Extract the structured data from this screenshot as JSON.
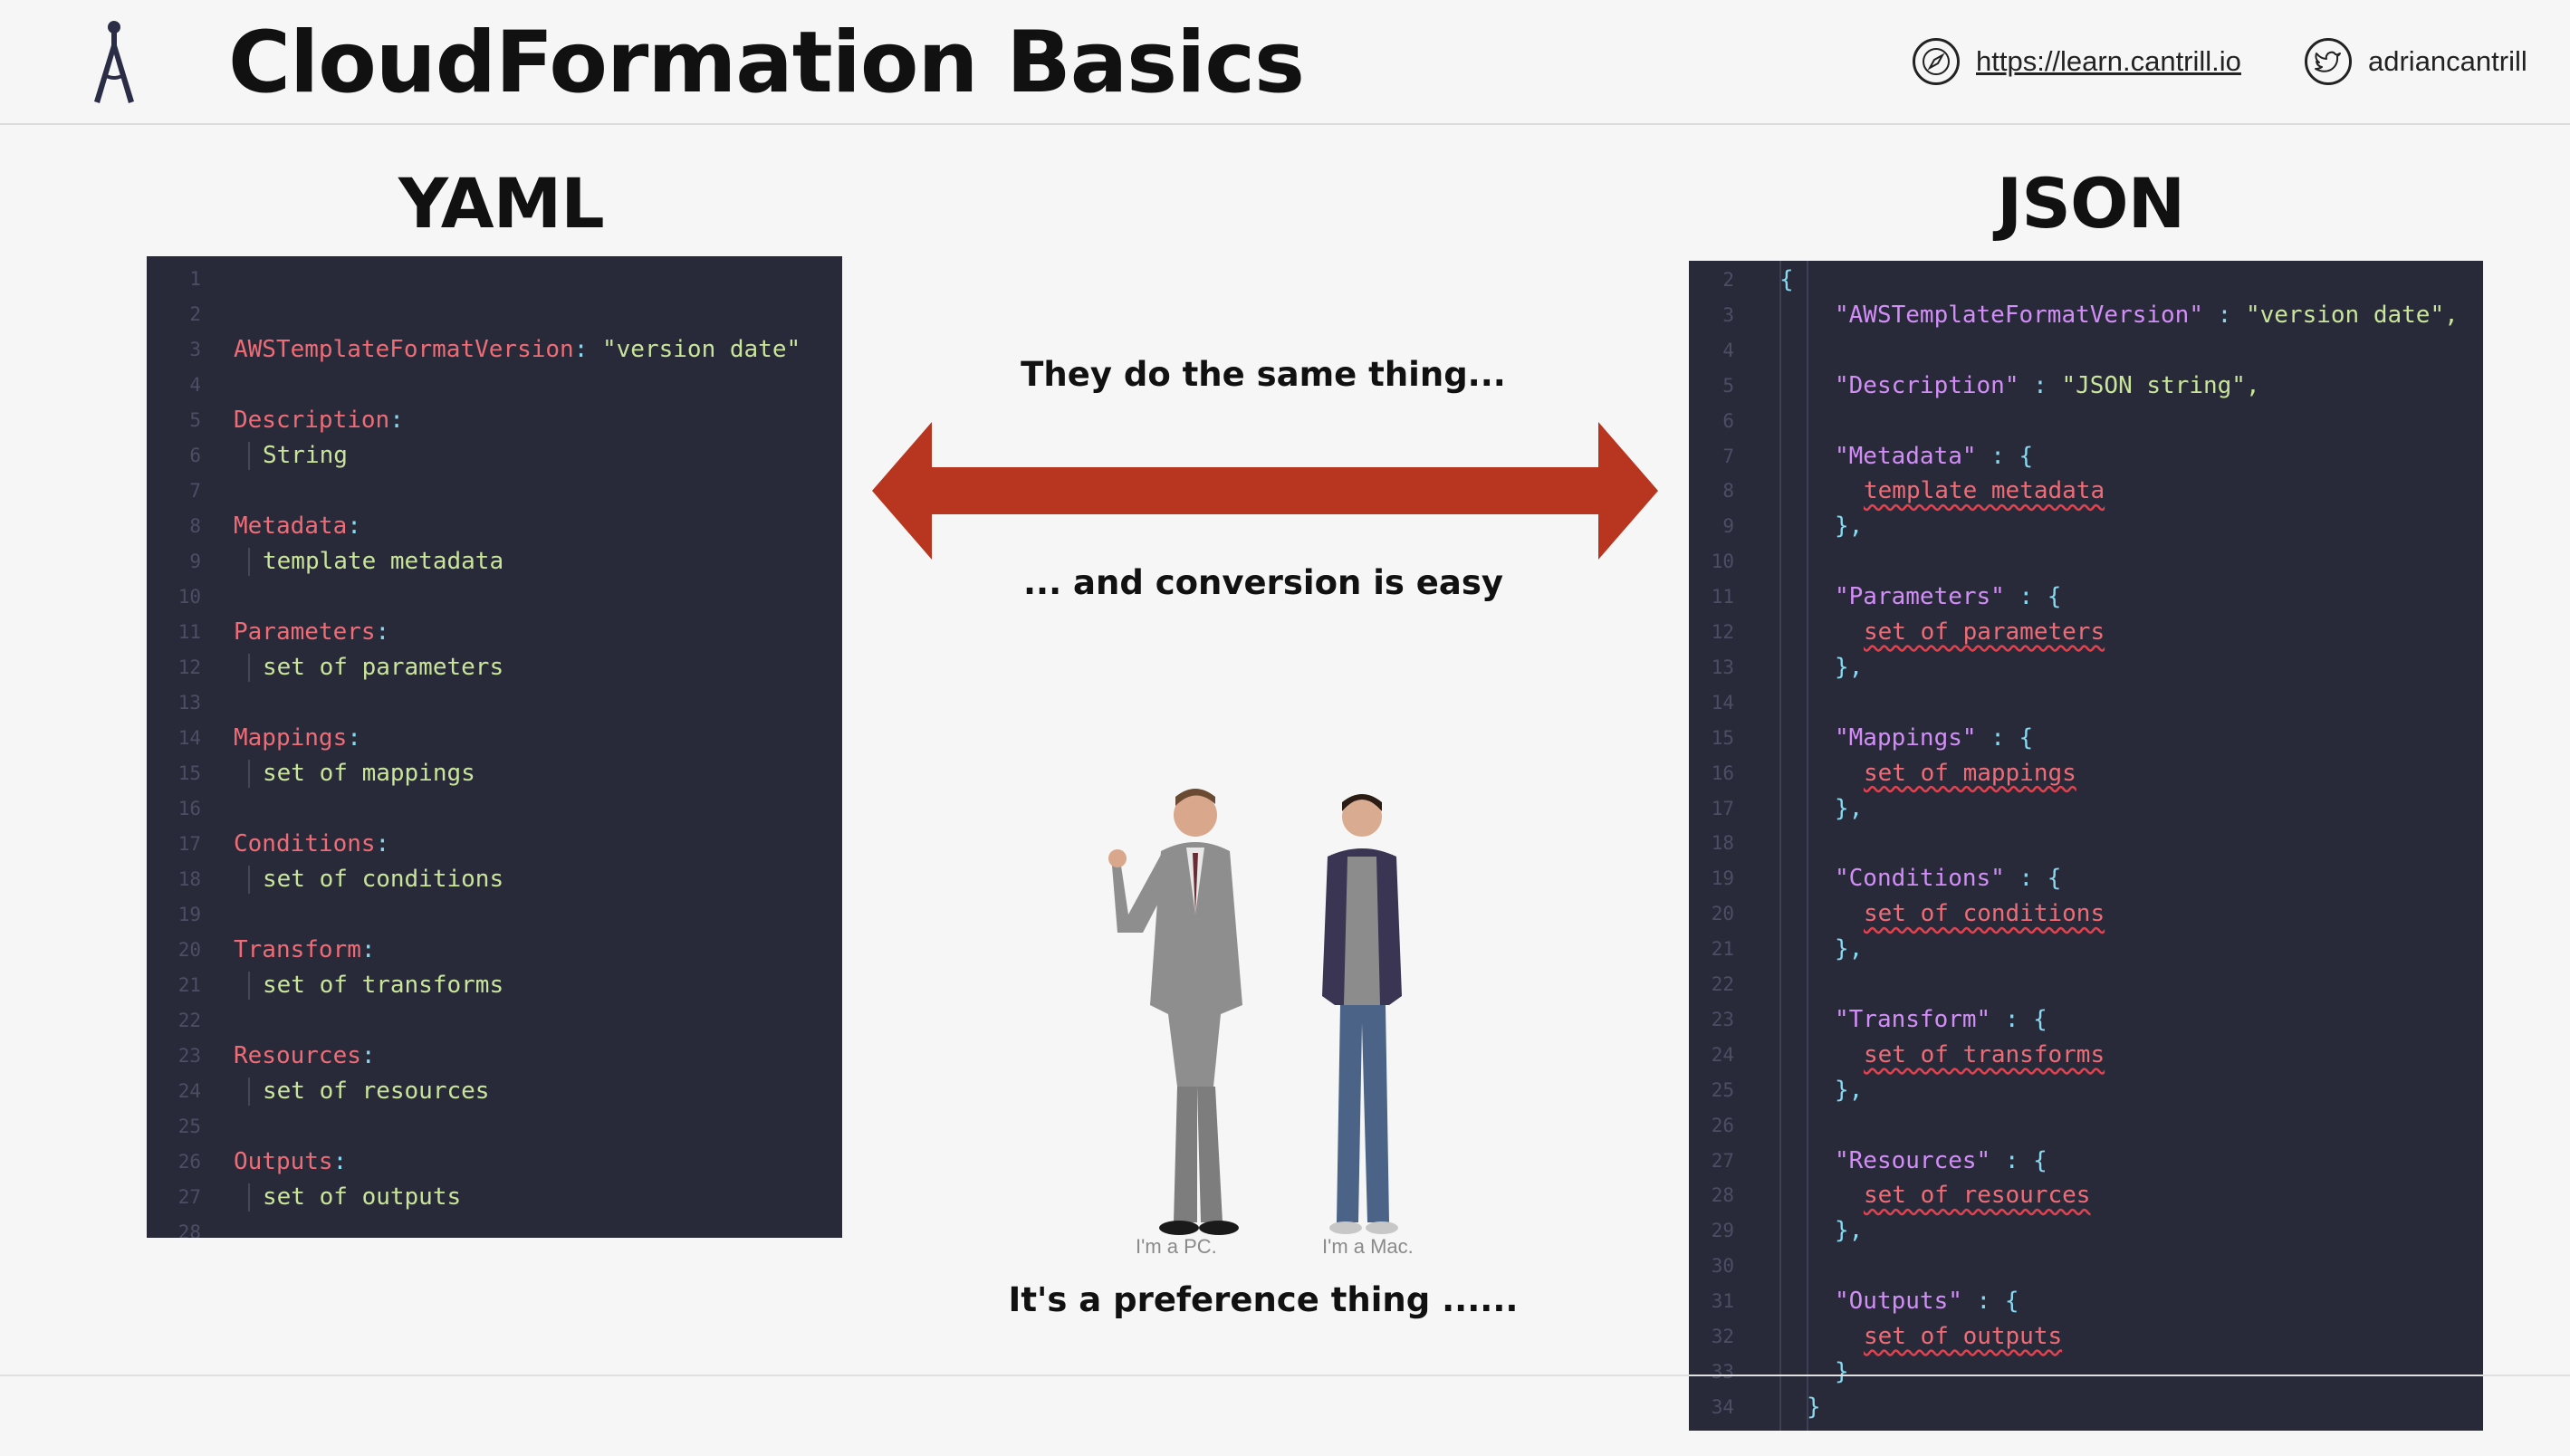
{
  "header": {
    "title": "CloudFormation Basics",
    "website": "https://learn.cantrill.io",
    "twitter": "adriancantrill",
    "logo_icon": "compass-icon",
    "website_icon": "safari-compass-icon",
    "twitter_icon": "twitter-bird-icon"
  },
  "yaml": {
    "title": "YAML",
    "lines": [
      {
        "n": "1",
        "key": "",
        "val": ""
      },
      {
        "n": "2",
        "key": "",
        "val": ""
      },
      {
        "n": "3",
        "key": "AWSTemplateFormatVersion",
        "val": "\"version date\""
      },
      {
        "n": "4",
        "key": "",
        "val": ""
      },
      {
        "n": "5",
        "key": "Description",
        "val": ""
      },
      {
        "n": "6",
        "key": "",
        "val": "String"
      },
      {
        "n": "7",
        "key": "",
        "val": ""
      },
      {
        "n": "8",
        "key": "Metadata",
        "val": ""
      },
      {
        "n": "9",
        "key": "",
        "val": "template metadata"
      },
      {
        "n": "10",
        "key": "",
        "val": ""
      },
      {
        "n": "11",
        "key": "Parameters",
        "val": ""
      },
      {
        "n": "12",
        "key": "",
        "val": "set of parameters"
      },
      {
        "n": "13",
        "key": "",
        "val": ""
      },
      {
        "n": "14",
        "key": "Mappings",
        "val": ""
      },
      {
        "n": "15",
        "key": "",
        "val": "set of mappings"
      },
      {
        "n": "16",
        "key": "",
        "val": ""
      },
      {
        "n": "17",
        "key": "Conditions",
        "val": ""
      },
      {
        "n": "18",
        "key": "",
        "val": "set of conditions"
      },
      {
        "n": "19",
        "key": "",
        "val": ""
      },
      {
        "n": "20",
        "key": "Transform",
        "val": ""
      },
      {
        "n": "21",
        "key": "",
        "val": "set of transforms"
      },
      {
        "n": "22",
        "key": "",
        "val": ""
      },
      {
        "n": "23",
        "key": "Resources",
        "val": ""
      },
      {
        "n": "24",
        "key": "",
        "val": "set of resources"
      },
      {
        "n": "25",
        "key": "",
        "val": ""
      },
      {
        "n": "26",
        "key": "Outputs",
        "val": ""
      },
      {
        "n": "27",
        "key": "",
        "val": "set of outputs"
      },
      {
        "n": "28",
        "key": "",
        "val": ""
      }
    ]
  },
  "json": {
    "title": "JSON",
    "lines": [
      {
        "n": "2",
        "kind": "open",
        "text": "{"
      },
      {
        "n": "3",
        "kind": "pair",
        "key": "\"AWSTemplateFormatVersion\"",
        "val": "\"version date\","
      },
      {
        "n": "4",
        "kind": "blank"
      },
      {
        "n": "5",
        "kind": "pair",
        "key": "\"Description\"",
        "val": "\"JSON string\","
      },
      {
        "n": "6",
        "kind": "blank"
      },
      {
        "n": "7",
        "kind": "obj",
        "key": "\"Metadata\""
      },
      {
        "n": "8",
        "kind": "body",
        "text": "template metadata"
      },
      {
        "n": "9",
        "kind": "close",
        "text": "},"
      },
      {
        "n": "10",
        "kind": "blank"
      },
      {
        "n": "11",
        "kind": "obj",
        "key": "\"Parameters\""
      },
      {
        "n": "12",
        "kind": "body",
        "text": "set of parameters"
      },
      {
        "n": "13",
        "kind": "close",
        "text": "},"
      },
      {
        "n": "14",
        "kind": "blank"
      },
      {
        "n": "15",
        "kind": "obj",
        "key": "\"Mappings\""
      },
      {
        "n": "16",
        "kind": "body",
        "text": "set of mappings"
      },
      {
        "n": "17",
        "kind": "close",
        "text": "},"
      },
      {
        "n": "18",
        "kind": "blank"
      },
      {
        "n": "19",
        "kind": "obj",
        "key": "\"Conditions\""
      },
      {
        "n": "20",
        "kind": "body",
        "text": "set of conditions"
      },
      {
        "n": "21",
        "kind": "close",
        "text": "},"
      },
      {
        "n": "22",
        "kind": "blank"
      },
      {
        "n": "23",
        "kind": "obj",
        "key": "\"Transform\""
      },
      {
        "n": "24",
        "kind": "body",
        "text": "set of transforms"
      },
      {
        "n": "25",
        "kind": "close",
        "text": "},"
      },
      {
        "n": "26",
        "kind": "blank"
      },
      {
        "n": "27",
        "kind": "obj",
        "key": "\"Resources\""
      },
      {
        "n": "28",
        "kind": "body",
        "text": "set of resources"
      },
      {
        "n": "29",
        "kind": "close",
        "text": "},"
      },
      {
        "n": "30",
        "kind": "blank"
      },
      {
        "n": "31",
        "kind": "obj",
        "key": "\"Outputs\""
      },
      {
        "n": "32",
        "kind": "body",
        "text": "set of outputs"
      },
      {
        "n": "33",
        "kind": "close",
        "text": "}"
      },
      {
        "n": "34",
        "kind": "end",
        "text": "}"
      }
    ]
  },
  "center": {
    "same_thing": "They do the same thing...",
    "conversion": "... and conversion is easy",
    "preference": "It's a preference thing ......",
    "caption_pc": "I'm a PC.",
    "caption_mac": "I'm a Mac."
  },
  "colors": {
    "code_bg": "#282a3a",
    "arrow": "#b8351f",
    "yaml_key": "#ee6c76",
    "yaml_value": "#c9e59a",
    "json_key": "#d28ef6",
    "json_punct": "#88d8ef"
  }
}
